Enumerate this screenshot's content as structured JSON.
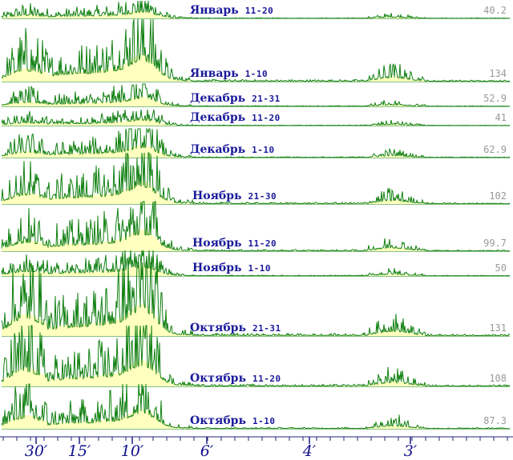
{
  "colors": {
    "line": "#108010",
    "fill": "#ffffc0",
    "label": "#1a1a9a",
    "peak": "#9a9a9a",
    "axis": "#202080"
  },
  "chart_data": {
    "type": "area",
    "x_tick_labels": [
      "30′",
      "15′",
      "10′",
      "6′",
      "4′",
      "3′"
    ],
    "series": [
      {
        "month": "Январь",
        "range": "11-20",
        "peak_label": "40.2",
        "peak": 40.2
      },
      {
        "month": "Январь",
        "range": "1-10",
        "peak_label": "134",
        "peak": 134
      },
      {
        "month": "Декабрь",
        "range": "21-31",
        "peak_label": "52.9",
        "peak": 52.9
      },
      {
        "month": "Декабрь",
        "range": "11-20",
        "peak_label": "41",
        "peak": 41
      },
      {
        "month": "Декабрь",
        "range": "1-10",
        "peak_label": "62.9",
        "peak": 62.9
      },
      {
        "month": "Ноябрь",
        "range": "21-30",
        "peak_label": "102",
        "peak": 102
      },
      {
        "month": "Ноябрь",
        "range": "11-20",
        "peak_label": "99.7",
        "peak": 99.7
      },
      {
        "month": "Ноябрь",
        "range": "1-10",
        "peak_label": "50",
        "peak": 50
      },
      {
        "month": "Октябрь",
        "range": "21-31",
        "peak_label": "131",
        "peak": 131
      },
      {
        "month": "Октябрь",
        "range": "11-20",
        "peak_label": "108",
        "peak": 108
      },
      {
        "month": "Октябрь",
        "range": "1-10",
        "peak_label": "87.3",
        "peak": 87.3
      }
    ]
  }
}
